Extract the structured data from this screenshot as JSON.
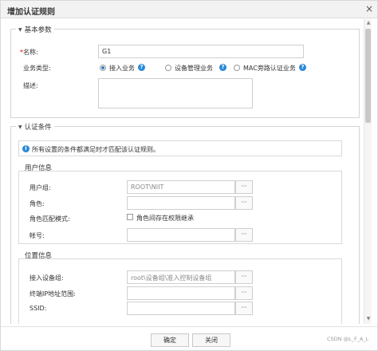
{
  "dialog": {
    "title": "增加认证规则",
    "close_glyph": "×"
  },
  "basic": {
    "legend": "基本参数",
    "name_required_mark": "*",
    "name_label": "名称:",
    "name_value": "G1",
    "service_type_label": "业务类型:",
    "service_options": [
      {
        "label": "接入业务",
        "selected": true
      },
      {
        "label": "设备管理业务",
        "selected": false
      },
      {
        "label": "MAC旁路认证业务",
        "selected": false
      }
    ],
    "help_glyph": "?",
    "desc_label": "描述:",
    "desc_value": ""
  },
  "conditions": {
    "legend": "认证条件",
    "info_glyph": "i",
    "info_text": "所有设置的条件都满足时才匹配该认证规则。",
    "user_info": {
      "title": "用户信息",
      "user_group_label": "用户组:",
      "user_group_value": "ROOT\\NIIT",
      "role_label": "角色:",
      "role_value": "",
      "role_match_label": "角色匹配模式:",
      "role_inherit_label": "角色间存在权限继承",
      "role_inherit_checked": false,
      "account_label": "帐号:",
      "account_value": ""
    },
    "location_info": {
      "title": "位置信息",
      "access_device_label": "接入设备组:",
      "access_device_value": "root\\设备组\\准入控制设备组",
      "terminal_ip_label": "终端IP地址范围:",
      "terminal_ip_value": "",
      "ssid_label": "SSID:",
      "ssid_value": ""
    },
    "browse_glyph": "···"
  },
  "footer": {
    "ok_label": "确定",
    "close_label": "关闭"
  },
  "watermark": "CSDN @L_F_A_L",
  "colors": {
    "accent": "#2a88d8",
    "required": "#ee0000",
    "border": "#d4d4d4"
  }
}
